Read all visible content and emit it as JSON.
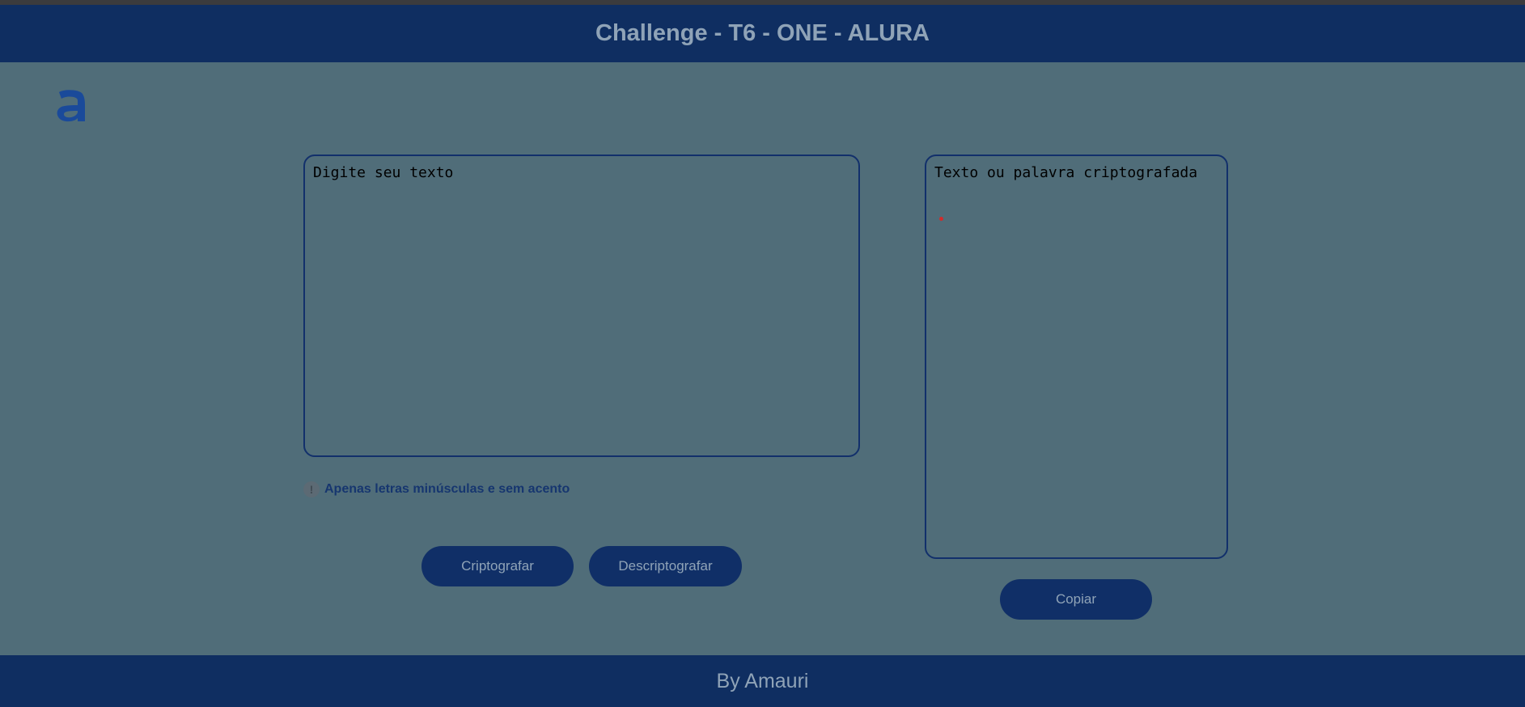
{
  "header": {
    "title": "Challenge - T6 - ONE - ALURA"
  },
  "logo": {
    "glyph": "a",
    "icon": "alura-logo-icon",
    "color": "#1a4a9a"
  },
  "input": {
    "placeholder": "Digite seu texto",
    "value": ""
  },
  "output": {
    "placeholder": "Texto ou palavra criptografada",
    "value": ""
  },
  "hint": {
    "icon": "info-circle-icon",
    "text": "Apenas letras minúsculas e sem acento"
  },
  "buttons": {
    "encrypt": "Criptografar",
    "decrypt": "Descriptografar",
    "copy": "Copiar"
  },
  "footer": {
    "text": "By Amauri"
  },
  "colors": {
    "background": "#506d79",
    "header": "#0f2e61",
    "button": "#102f67",
    "accent_text": "#8fa3b7"
  }
}
